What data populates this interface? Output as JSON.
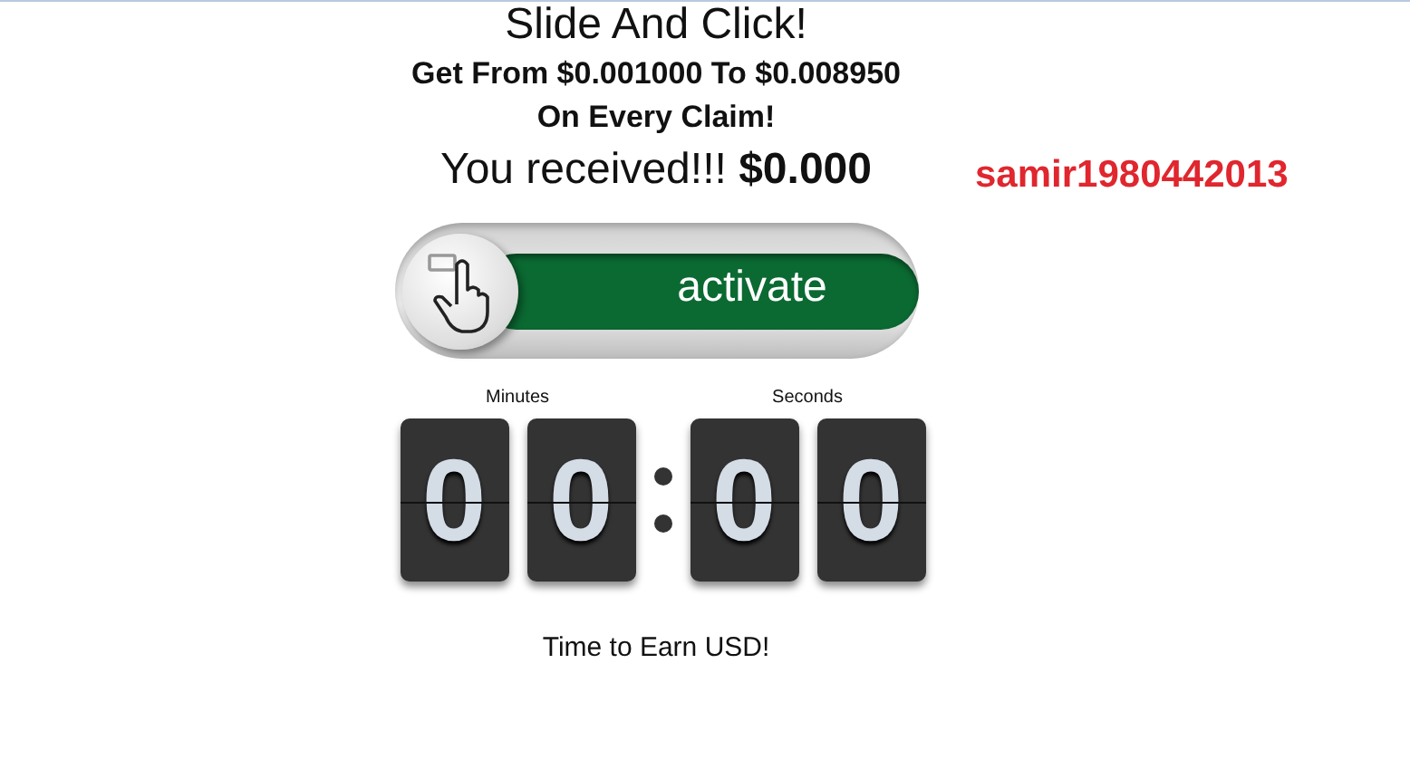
{
  "title": "Slide And Click!",
  "reward_range": "Get From $0.001000 To $0.008950",
  "reward_note": "On Every Claim!",
  "received": "You received!!! **$0.000**",
  "username": "samir1980442013",
  "slider": {
    "label": "activate"
  },
  "timer": {
    "groups": [
      {
        "label": "Minutes",
        "digits": [
          "0",
          "0"
        ]
      },
      {
        "label": "Seconds",
        "digits": [
          "0",
          "0"
        ]
      }
    ]
  },
  "footer": "Time to Earn USD!"
}
